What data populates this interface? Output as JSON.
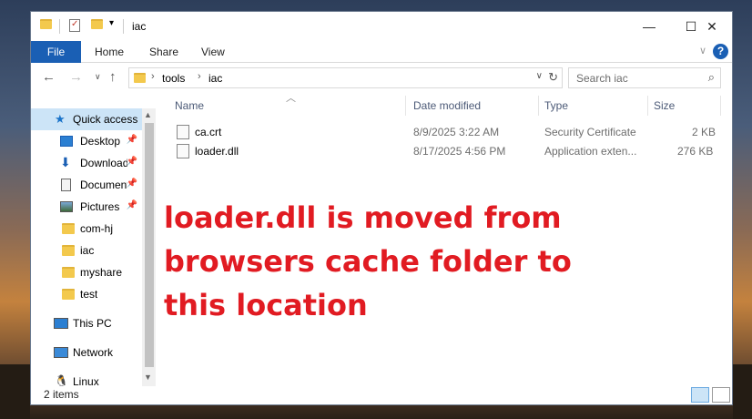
{
  "window": {
    "title": "iac",
    "controls": {
      "minimize": "—",
      "maximize": "☐",
      "close": "✕"
    }
  },
  "ribbon": {
    "tabs": [
      "File",
      "Home",
      "Share",
      "View"
    ],
    "help": "?"
  },
  "address": {
    "segments": [
      "tools",
      "iac"
    ],
    "search_placeholder": "Search iac"
  },
  "columns": [
    "Name",
    "Date modified",
    "Type",
    "Size"
  ],
  "sidebar": {
    "items": [
      {
        "label": "Quick access",
        "icon": "star-icon",
        "pinned": false,
        "active": true
      },
      {
        "label": "Desktop",
        "icon": "desktop-icon",
        "pinned": true
      },
      {
        "label": "Downloads",
        "icon": "download-icon",
        "pinned": true
      },
      {
        "label": "Documents",
        "icon": "document-icon",
        "pinned": true
      },
      {
        "label": "Pictures",
        "icon": "pictures-icon",
        "pinned": true
      },
      {
        "label": "com-hj",
        "icon": "folder-icon",
        "pinned": false
      },
      {
        "label": "iac",
        "icon": "folder-icon",
        "pinned": false
      },
      {
        "label": "myshare",
        "icon": "folder-icon",
        "pinned": false
      },
      {
        "label": "test",
        "icon": "folder-icon",
        "pinned": false
      },
      {
        "label": "This PC",
        "icon": "computer-icon",
        "pinned": false
      },
      {
        "label": "Network",
        "icon": "network-icon",
        "pinned": false
      },
      {
        "label": "Linux",
        "icon": "linux-icon",
        "pinned": false
      }
    ],
    "pin_glyph": "📌"
  },
  "files": [
    {
      "name": "ca.crt",
      "date": "8/9/2025 3:22 AM",
      "type": "Security Certificate",
      "size": "2 KB",
      "icon": "certificate-icon"
    },
    {
      "name": "loader.dll",
      "date": "8/17/2025 4:56 PM",
      "type": "Application exten...",
      "size": "276 KB",
      "icon": "dll-icon"
    }
  ],
  "annotation": "loader.dll is moved from browsers cache folder to this location",
  "status": {
    "item_count": "2 items"
  },
  "colors": {
    "accent": "#1a5fb4",
    "annotation": "#e11b22",
    "selection": "#cce4f7"
  }
}
